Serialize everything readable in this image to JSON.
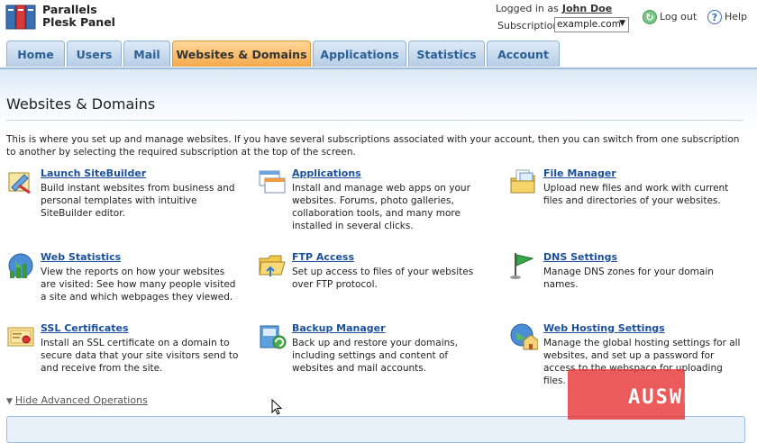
{
  "app": {
    "brand_line1": "Parallels",
    "brand_line2": "Plesk Panel"
  },
  "session": {
    "logged_in_prefix": "Logged in as",
    "user": "John Doe",
    "subscription_label": "Subscription",
    "subscription_value": "example.com",
    "logout": "Log out",
    "help": "Help"
  },
  "tabs": [
    {
      "label": "Home"
    },
    {
      "label": "Users"
    },
    {
      "label": "Mail"
    },
    {
      "label": "Websites & Domains",
      "active": true
    },
    {
      "label": "Applications"
    },
    {
      "label": "Statistics"
    },
    {
      "label": "Account"
    }
  ],
  "page": {
    "title": "Websites & Domains",
    "intro": "This is where you set up and manage websites. If you have several subscriptions associated with your account, then you can switch from one subscription to another by selecting the required subscription at the top of the screen."
  },
  "tools": [
    {
      "title": "Launch SiteBuilder",
      "desc": "Build instant websites from business and personal templates with intuitive SiteBuilder editor.",
      "icon": "sitebuilder-icon"
    },
    {
      "title": "Applications",
      "desc": "Install and manage web apps on your websites. Forums, photo galleries, collaboration tools, and many more installed in several clicks.",
      "icon": "applications-icon"
    },
    {
      "title": "File Manager",
      "desc": "Upload new files and work with current files and directories of your websites.",
      "icon": "file-manager-icon"
    },
    {
      "title": "Web Statistics",
      "desc": "View the reports on how your websites are visited: See how many people visited a site and which webpages they viewed.",
      "icon": "web-statistics-icon"
    },
    {
      "title": "FTP Access",
      "desc": "Set up access to files of your websites over FTP protocol.",
      "icon": "ftp-folder-icon"
    },
    {
      "title": "DNS Settings",
      "desc": "Manage DNS zones for your domain names.",
      "icon": "dns-flag-icon"
    },
    {
      "title": "SSL Certificates",
      "desc": "Install an SSL certificate on a domain to secure data that your site visitors send to and receive from the site.",
      "icon": "ssl-certificate-icon"
    },
    {
      "title": "Backup Manager",
      "desc": "Back up and restore your domains, including settings and content of websites and mail accounts.",
      "icon": "backup-icon"
    },
    {
      "title": "Web Hosting Settings",
      "desc": "Manage the global hosting settings for all websites, and set up a password for access to the webspace for uploading files.",
      "icon": "hosting-settings-icon"
    }
  ],
  "advanced": {
    "label": "Hide Advanced Operations"
  },
  "watermark": {
    "text": "AUSWEB"
  }
}
